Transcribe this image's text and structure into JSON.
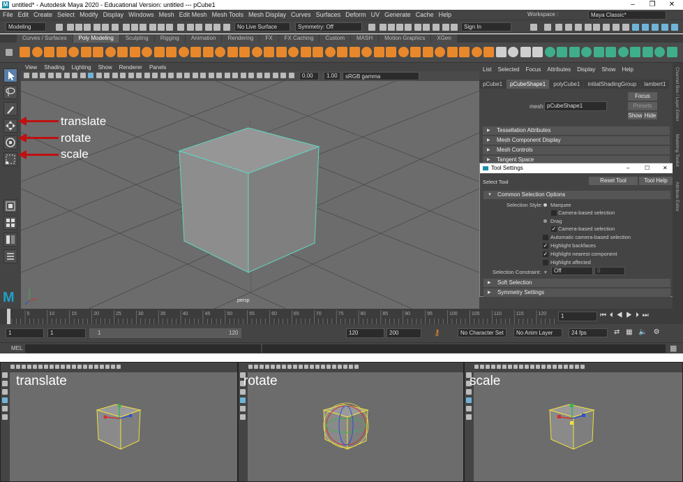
{
  "window": {
    "title": "untitled* - Autodesk Maya 2020 - Educational Version: untitled   ---   pCube1",
    "controls": [
      "–",
      "❐",
      "✕"
    ]
  },
  "menus": [
    "File",
    "Edit",
    "Create",
    "Select",
    "Modify",
    "Display",
    "Windows",
    "Mesh",
    "Edit Mesh",
    "Mesh Tools",
    "Mesh Display",
    "Curves",
    "Surfaces",
    "Deform",
    "UV",
    "Generate",
    "Cache",
    "Help"
  ],
  "workspace": {
    "label": "Workspace :",
    "value": "Maya Classic*"
  },
  "status": {
    "mode": "Modeling",
    "live_surface": "No Live Surface",
    "symmetry": "Symmetry: Off",
    "sign_in": "Sign In"
  },
  "shelf_tabs": [
    "Curves / Surfaces",
    "Poly Modeling",
    "Sculpting",
    "Rigging",
    "Animation",
    "Rendering",
    "FX",
    "FX Caching",
    "Custom",
    "MASH",
    "Motion Graphics",
    "XGen"
  ],
  "shelf_active": 1,
  "viewport": {
    "menus": [
      "View",
      "Shading",
      "Lighting",
      "Show",
      "Renderer",
      "Panels"
    ],
    "exposure": "0.00",
    "gamma": "1.00",
    "color_space": "sRGB gamma",
    "camera_label": "persp"
  },
  "annotations": {
    "translate": "translate",
    "rotate": "rotate",
    "scale": "scale"
  },
  "attribute_editor": {
    "menus": [
      "List",
      "Selected",
      "Focus",
      "Attributes",
      "Display",
      "Show",
      "Help"
    ],
    "tabs": [
      "pCube1",
      "pCubeShape1",
      "polyCube1",
      "initialShadingGroup",
      "lambert1"
    ],
    "active_tab": 1,
    "mesh_label": "mesh:",
    "mesh_value": "pCubeShape1",
    "focus": "Focus",
    "presets": "Presets",
    "show": "Show",
    "hide": "Hide",
    "sections": [
      "Tessellation Attributes",
      "Mesh Component Display",
      "Mesh Controls",
      "Tangent Space"
    ]
  },
  "tool_settings": {
    "title": "Tool Settings",
    "tool_name": "Select Tool",
    "reset": "Reset Tool",
    "help": "Tool Help",
    "section_open": "Common Selection Options",
    "selection_style_label": "Selection Style:",
    "marquee": "Marquee",
    "camera_based_1": "Camera-based selection",
    "drag": "Drag",
    "camera_based_2": "Camera-based selection",
    "auto_camera": "Automatic camera-based selection",
    "highlight_backfaces": "Highlight backfaces",
    "highlight_nearest": "Highlight nearest component",
    "highlight_affected": "Highlight affected",
    "constraint_label": "Selection Constraint:",
    "constraint_value": "Off",
    "constraint_num": "0",
    "soft_selection": "Soft Selection",
    "symmetry_settings": "Symmetry Settings"
  },
  "right_strip": [
    "Channel Box / Layer Editor",
    "Modeling Toolkit",
    "Attribute Editor"
  ],
  "timeline": {
    "ticks": [
      "5",
      "10",
      "15",
      "20",
      "25",
      "30",
      "35",
      "40",
      "45",
      "50",
      "55",
      "60",
      "65",
      "70",
      "75",
      "80",
      "85",
      "90",
      "95",
      "100",
      "105",
      "110",
      "115",
      "120"
    ],
    "current_frame": "1"
  },
  "range": {
    "start": "1",
    "playback_start": "1",
    "slider_start": "1",
    "slider_end": "120",
    "playback_end": "120",
    "end": "200",
    "character_set": "No Character Set",
    "anim_layer": "No Anim Layer",
    "fps": "24 fps"
  },
  "command": {
    "label": "MEL"
  },
  "bottom_panels": [
    {
      "label": "translate"
    },
    {
      "label": "rotate"
    },
    {
      "label": "scale"
    }
  ],
  "colors": {
    "ui_bg": "#444444",
    "viewport": "#6c6c6c",
    "selection_wire": "#5fd6c0",
    "selected_yellow": "#f0e040",
    "shelf_orange": "#e8882a",
    "shelf_green": "#3fae8a",
    "arrow_red": "#c01010"
  }
}
